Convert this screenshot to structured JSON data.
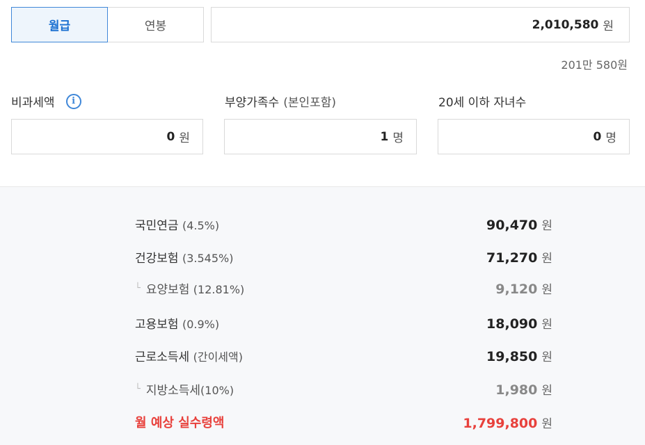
{
  "tabs": [
    {
      "label": "월급",
      "active": true
    },
    {
      "label": "연봉",
      "active": false
    }
  ],
  "salary": {
    "value": "2,010,580",
    "unit": "원",
    "korean": "201만 580원"
  },
  "fields": {
    "nontax": {
      "label": "비과세액",
      "value": "0",
      "unit": "원"
    },
    "dependents": {
      "label": "부양가족수",
      "label_note": "(본인포함)",
      "value": "1",
      "unit": "명"
    },
    "children": {
      "label": "20세 이하 자녀수",
      "value": "0",
      "unit": "명"
    }
  },
  "results": [
    {
      "label": "국민연금",
      "pct": "(4.5%)",
      "amount": "90,470",
      "unit": "원"
    },
    {
      "label": "건강보험",
      "pct": "(3.545%)",
      "amount": "71,270",
      "unit": "원"
    },
    {
      "label": "요양보험",
      "pct": "(12.81%)",
      "amount": "9,120",
      "unit": "원"
    },
    {
      "label": "고용보험",
      "pct": "(0.9%)",
      "amount": "18,090",
      "unit": "원"
    },
    {
      "label": "근로소득세",
      "pct": "(간이세액)",
      "amount": "19,850",
      "unit": "원"
    },
    {
      "label": "지방소득세",
      "pct": "(10%)",
      "amount": "1,980",
      "unit": "원"
    },
    {
      "label": "월 예상 실수령액",
      "pct": "",
      "amount": "1,799,800",
      "unit": "원"
    }
  ],
  "colors": {
    "accent": "#3f87d8",
    "total": "#e8413c"
  },
  "icons": {
    "info": "info-icon",
    "sub_marker": "corner-icon"
  }
}
